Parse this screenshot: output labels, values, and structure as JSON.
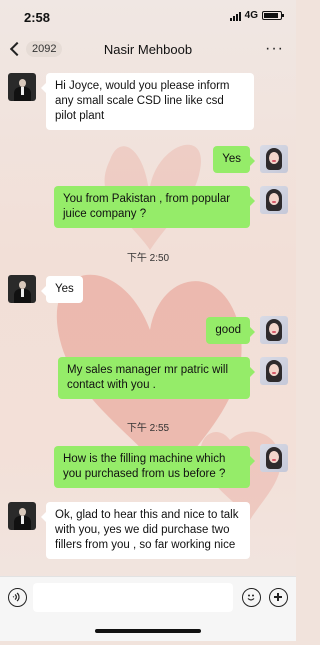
{
  "status": {
    "time": "2:58",
    "network": "4G"
  },
  "nav": {
    "unread_count": "2092",
    "contact_name": "Nasir Mehboob",
    "more_label": "···"
  },
  "messages": [
    {
      "side": "in",
      "text": "Hi Joyce, would you please inform any small scale CSD line like csd pilot plant"
    },
    {
      "side": "out",
      "text": "Yes"
    },
    {
      "side": "out",
      "text": "You from Pakistan , from popular juice company ?"
    },
    {
      "type": "time",
      "text": "下午 2:50"
    },
    {
      "side": "in",
      "text": "Yes"
    },
    {
      "side": "out",
      "text": "good"
    },
    {
      "side": "out",
      "text": "My sales manager mr patric will contact with you ."
    },
    {
      "type": "time",
      "text": "下午 2:55"
    },
    {
      "side": "out",
      "text": "How is the filling machine which you purchased from us before ?"
    },
    {
      "side": "in",
      "text": "Ok,  glad to hear this and nice to talk with you, yes we did purchase  two fillers from you , so far working nice"
    }
  ],
  "input": {
    "value": ""
  },
  "icons": {
    "back": "chevron-left-icon",
    "more": "more-icon",
    "voice": "voice-icon",
    "emoji": "emoji-icon",
    "plus": "plus-icon"
  },
  "colors": {
    "outgoing_bubble": "#95ec69",
    "incoming_bubble": "#ffffff"
  }
}
